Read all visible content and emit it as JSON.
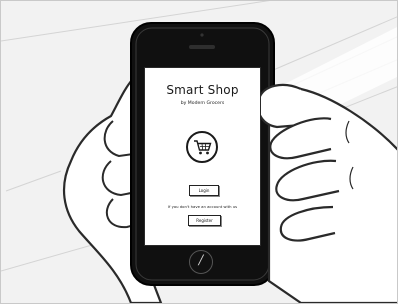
{
  "app": {
    "title": "Smart Shop",
    "subtitle": "by Modern Grocers"
  },
  "icons": {
    "cart": "shopping-cart-icon",
    "home": "home-button-icon"
  },
  "actions": {
    "login_label": "Login",
    "account_note": "If you don't have an account with us",
    "register_label": "Register"
  },
  "home_button_glyph": "∕",
  "colors": {
    "ink": "#1a1a1a",
    "phone_body": "#111111",
    "background": "#f2f2f2"
  }
}
